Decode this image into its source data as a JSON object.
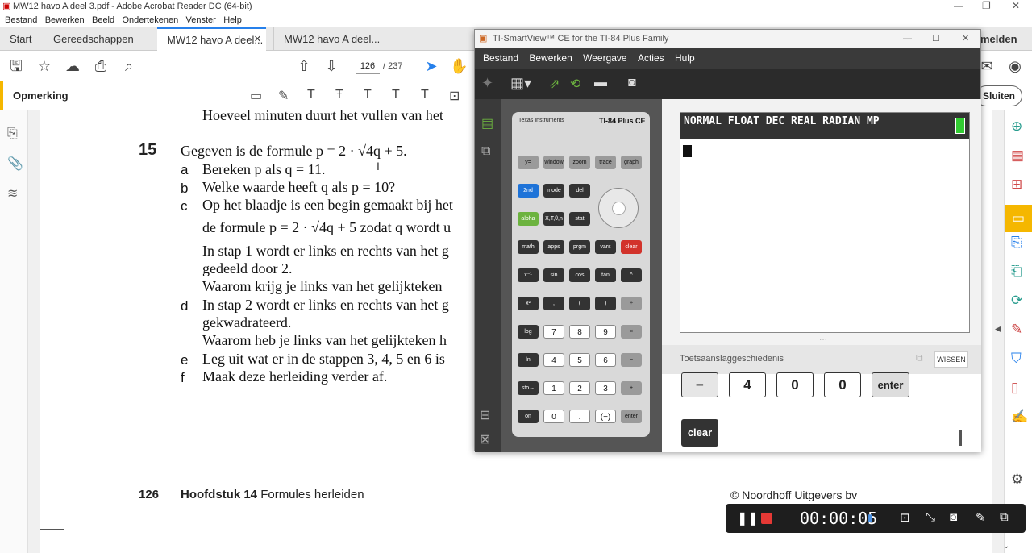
{
  "app": {
    "window_title": "MW12 havo A deel 3.pdf - Adobe Acrobat Reader DC (64-bit)",
    "menu": [
      "Bestand",
      "Bewerken",
      "Beeld",
      "Ondertekenen",
      "Venster",
      "Help"
    ],
    "tabs": [
      "Start",
      "Gereedschappen",
      "MW12 havo A deel...",
      "MW12 havo A deel..."
    ],
    "tab_right_text": "melden",
    "page_current": "126",
    "page_total": "/ 237",
    "comment_label": "Opmerking",
    "close_label": "Sluiten",
    "icons": {
      "save": "save-icon",
      "star": "star-icon",
      "upload": "upload-icon",
      "print": "print-icon",
      "zoom": "zoom-icon",
      "up": "page-up-icon",
      "down": "page-down-icon",
      "cursor": "select-icon",
      "hand": "hand-icon"
    }
  },
  "doc": {
    "top_line": "Hoeveel minuten duurt het vullen van het",
    "question_number": "15",
    "intro": "Gegeven is de formule p = 2 · √4q + 5.",
    "items": [
      {
        "label": "a",
        "text": "Bereken p als q = 11."
      },
      {
        "label": "b",
        "text": "Welke waarde heeft q als p = 10?"
      },
      {
        "label": "c",
        "text": "Op het blaadje is een begin gemaakt bij het"
      },
      {
        "label": "",
        "text": "de formule p = 2 · √4q + 5 zodat q wordt u"
      },
      {
        "label": "",
        "text": "In stap 1 wordt er links en rechts van het g"
      },
      {
        "label": "",
        "text": "gedeeld door 2."
      },
      {
        "label": "",
        "text": "Waarom krijg je links van het gelijkteken"
      },
      {
        "label": "d",
        "text": "In stap 2 wordt er links en rechts van het g"
      },
      {
        "label": "",
        "text": "gekwadrateerd."
      },
      {
        "label": "",
        "text": "Waarom heb je links van het gelijkteken h"
      },
      {
        "label": "e",
        "text": "Leg uit wat er in de stappen 3, 4, 5 en 6 is"
      },
      {
        "label": "f",
        "text": "Maak deze herleiding verder af."
      }
    ],
    "footer_page": "126",
    "footer_chapter_bold": "Hoofdstuk 14",
    "footer_chapter": "Formules herleiden",
    "footer_copyright": "© Noordhoff Uitgevers bv"
  },
  "ti": {
    "title": "TI-SmartView™ CE for the TI-84 Plus Family",
    "menu": [
      "Bestand",
      "Bewerken",
      "Weergave",
      "Acties",
      "Hulp"
    ],
    "brand": "Texas Instruments",
    "model": "TI-84 Plus CE",
    "screen_status": "NORMAL FLOAT DEC REAL RADIAN MP",
    "history_label": "Toetsaanslaggeschiedenis",
    "history_clear": "WISSEN",
    "history_keys": [
      "−",
      "4",
      "0",
      "0",
      "enter"
    ],
    "history_clear_key": "clear",
    "keys": {
      "row_top": [
        "y=",
        "window",
        "zoom",
        "trace",
        "graph"
      ],
      "row2": [
        "2nd",
        "mode",
        "del"
      ],
      "row3": [
        "alpha",
        "X,T,θ,n",
        "stat"
      ],
      "row4": [
        "math",
        "apps",
        "prgm",
        "vars",
        "clear"
      ],
      "row5": [
        "x⁻¹",
        "sin",
        "cos",
        "tan",
        "^"
      ],
      "row6": [
        "x²",
        ",",
        "(",
        ")",
        "÷"
      ],
      "row7": [
        "log",
        "7",
        "8",
        "9",
        "×"
      ],
      "row8": [
        "ln",
        "4",
        "5",
        "6",
        "−"
      ],
      "row9": [
        "sto→",
        "1",
        "2",
        "3",
        "+"
      ],
      "row10": [
        "on",
        "0",
        ".",
        "(−)",
        "enter"
      ]
    }
  },
  "recorder": {
    "time": "00:00:05"
  }
}
